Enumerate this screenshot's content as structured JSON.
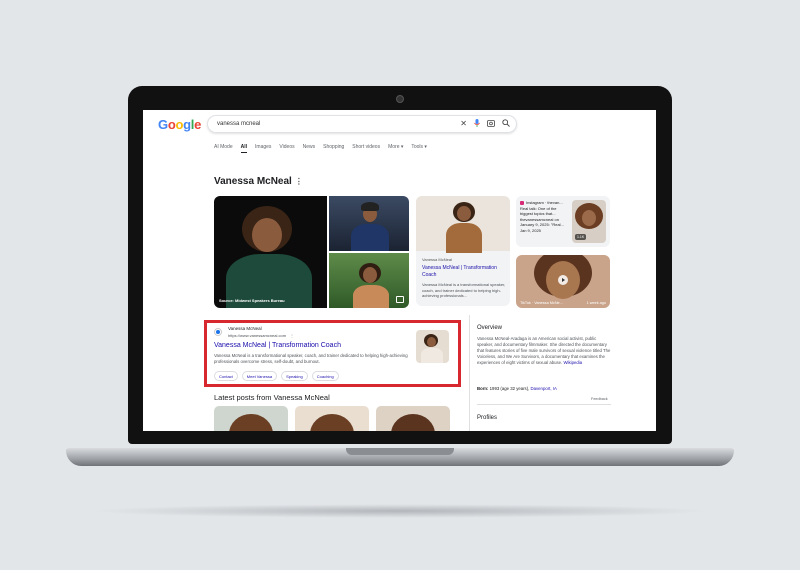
{
  "search": {
    "logo_letters": [
      "G",
      "o",
      "o",
      "g",
      "l",
      "e"
    ],
    "query": "vanessa mcneal",
    "icons": [
      "close-icon",
      "mic-icon",
      "lens-icon",
      "search-icon"
    ]
  },
  "tabs": [
    "AI Mode",
    "All",
    "Images",
    "Videos",
    "News",
    "Shopping",
    "Short videos",
    "More ▾",
    "Tools ▾"
  ],
  "active_tab": "All",
  "entity": {
    "title": "Vanessa McNeal"
  },
  "images": {
    "main_caption": "Source: Midwest Speakers Bureau"
  },
  "card_website": {
    "source": "Vanessa McNeal",
    "title": "Vanessa McNeal | Transformation Coach",
    "desc": "Vanessa McNeal is a transformational speaker, coach, and trainer dedicated to helping high-achieving professionals..."
  },
  "card_instagram": {
    "text": "Instagram · thevan... Real talk: One of the biggest topics that... thevanessamcneal on January 9, 2025: \"Real... Jan 9, 2025",
    "badge": "1.1K"
  },
  "card_tiktok": {
    "caption": "TikTok · Vanessa McNe...",
    "ago": "1 week ago"
  },
  "result": {
    "site": "Vanessa McNeal",
    "url": "https://www.vanessamcneal.com",
    "url_more": "⋮",
    "title": "Vanessa McNeal | Transformation Coach",
    "desc": "Vanessa McNeal is a transformational speaker, coach, and trainer dedicated to helping high-achieving professionals overcome stress, self-doubt, and burnout.",
    "chips": [
      "Contact",
      "Meet Vanessa",
      "Speaking",
      "Coaching"
    ],
    "highlight_color": "#d7272f"
  },
  "latest_heading": "Latest posts from Vanessa McNeal",
  "overview": {
    "title": "Overview",
    "text": "Vanessa McNeal-Aradaga is an American social activist, public speaker, and documentary filmmaker. She directed the documentary that features stories of five male survivors of sexual violence titled The Voiceless, and We Are Survivors, a documentary that examines the experiences of eight victims of sexual abuse.",
    "wiki": "Wikipedia",
    "born_label": "Born:",
    "born_value": "1993 (age 32 years),",
    "born_place": "Davenport, IA",
    "feedback": "Feedback",
    "profiles": "Profiles"
  }
}
